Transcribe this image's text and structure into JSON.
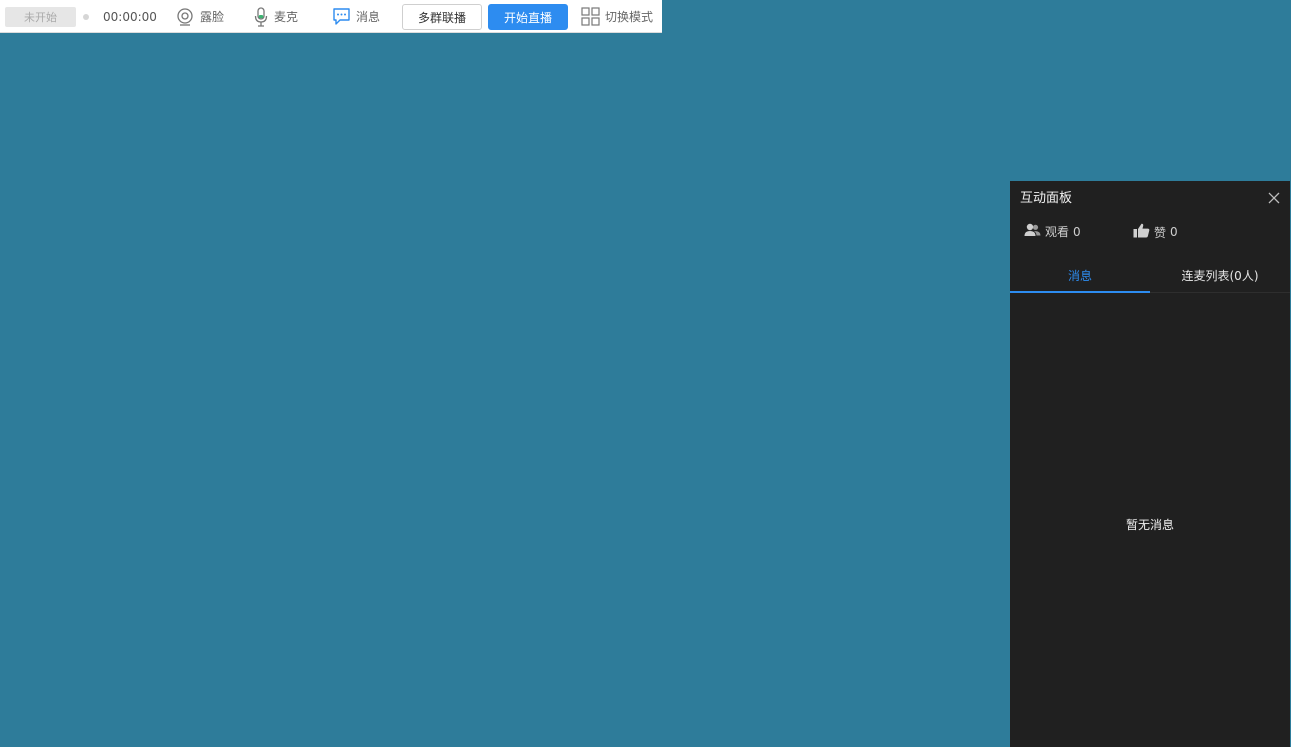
{
  "toolbar": {
    "status": "未开始",
    "timer": "00:00:00",
    "face_label": "露脸",
    "mic_label": "麦克",
    "message_label": "消息",
    "multi_group_label": "多群联播",
    "start_live_label": "开始直播",
    "switch_mode_label": "切换模式",
    "icons": {
      "face": "camera-icon",
      "mic": "microphone-icon",
      "message": "chat-bubble-icon",
      "mode": "grid-icon",
      "status_dot": "status-dot"
    },
    "colors": {
      "primary": "#2d8cf0",
      "mic_green": "#3cb371",
      "message_blue": "#2d8cf0"
    }
  },
  "panel": {
    "title": "互动面板",
    "close_icon": "close-icon",
    "stats": {
      "viewers_label": "观看",
      "viewers": "0",
      "likes_label": "赞",
      "likes": "0"
    },
    "tabs": [
      {
        "label": "消息",
        "active": true
      },
      {
        "label": "连麦列表(0人)",
        "active": false
      }
    ],
    "empty_text": "暂无消息",
    "colors": {
      "background": "#202020",
      "accent": "#2d8cf0"
    }
  },
  "stage": {
    "background": "#2e7c9a"
  }
}
